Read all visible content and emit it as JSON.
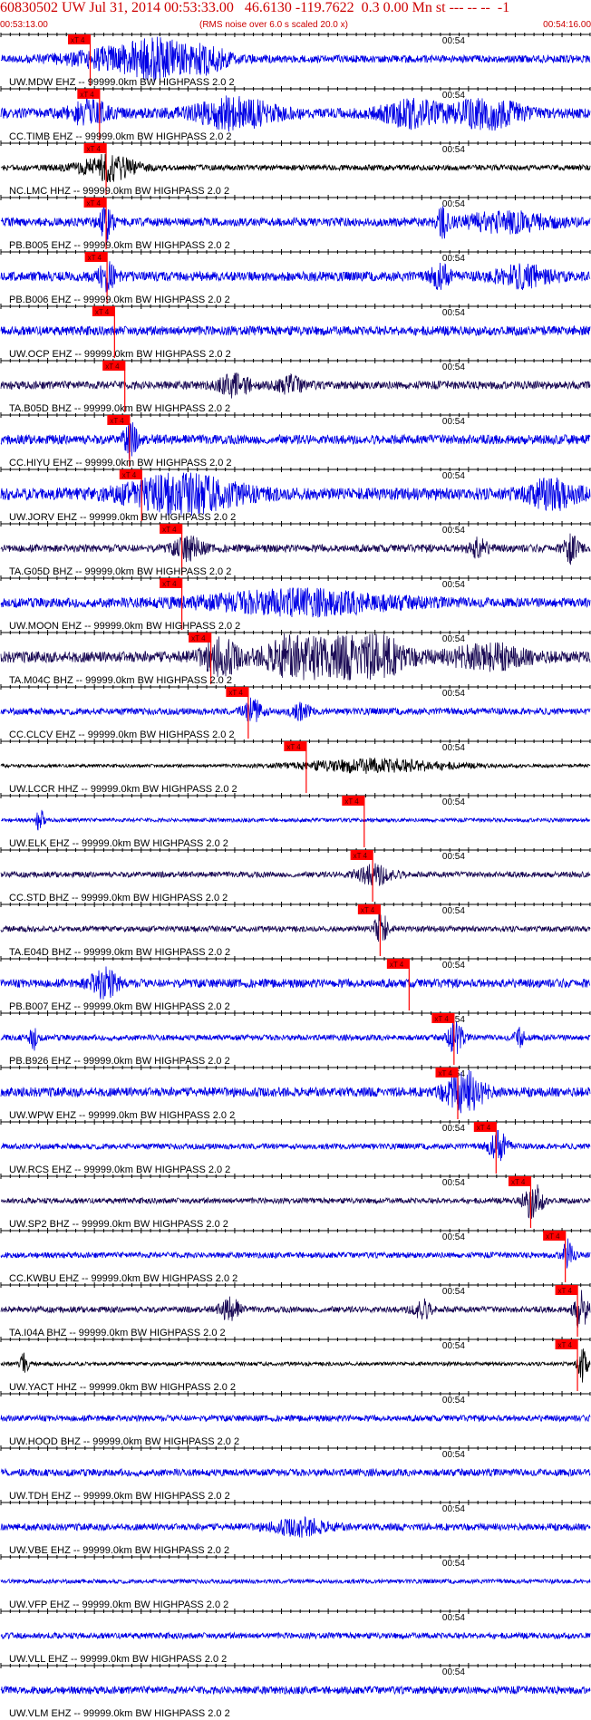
{
  "header": {
    "title": "60830502 UW Jul 31, 2014 00:53:33.00   46.6130 -119.7622  0.3 0.00 Mn st --- -- --  -1",
    "start_time": "00:53:13.00",
    "end_time": "00:54:16.00",
    "note": "(RMS noise over 6.0 s scaled 20.0 x)"
  },
  "chart_data": {
    "type": "line",
    "x_unit": "s",
    "x_range": [
      0,
      63
    ],
    "minute_mark_label": "00:54",
    "minute_mark_offset_s": 47,
    "pick_label": "xT 4",
    "colors": {
      "pick": "#ff0000",
      "pick_label_bg": "#ff0000",
      "pick_label_text": "#4a0000",
      "axis": "#000000",
      "blue_trace": "#0000e6",
      "dark_trace": "#1a0a55",
      "black_trace": "#000000"
    },
    "traces": [
      {
        "label": "UW.MDW EHZ -- 99999.0km BW  HIGHPASS  2.0  2",
        "color": "blue",
        "pick_s": 9.5,
        "amp": 0.16,
        "events": [
          [
            15,
            14,
            0.55
          ],
          [
            17,
            5,
            0.3
          ],
          [
            22,
            4,
            0.35
          ]
        ]
      },
      {
        "label": "CC.TIMB EHZ -- 99999.0km BW  HIGHPASS  2.0  2",
        "color": "blue",
        "pick_s": 10.5,
        "amp": 0.22,
        "events": [
          [
            9.5,
            4,
            0.45
          ],
          [
            25,
            8,
            0.6
          ],
          [
            44,
            6,
            0.5
          ],
          [
            52,
            7,
            0.55
          ]
        ]
      },
      {
        "label": "NC.LMC HHZ -- 99999.0km BW  HIGHPASS  2.0  2",
        "color": "black",
        "pick_s": 11.2,
        "amp": 0.12,
        "events": [
          [
            11.5,
            6,
            0.5
          ]
        ]
      },
      {
        "label": "PB.B005 EHZ -- 99999.0km BW  HIGHPASS  2.0  2",
        "color": "blue",
        "pick_s": 11.2,
        "amp": 0.18,
        "events": [
          [
            11.2,
            1.5,
            0.7
          ],
          [
            47.2,
            1,
            0.6
          ],
          [
            54,
            10,
            0.35
          ]
        ]
      },
      {
        "label": "PB.B006 EHZ -- 99999.0km BW  HIGHPASS  2.0  2",
        "color": "blue",
        "pick_s": 11.3,
        "amp": 0.2,
        "events": [
          [
            11.3,
            2,
            0.5
          ],
          [
            47,
            2,
            0.45
          ],
          [
            56,
            6,
            0.4
          ]
        ]
      },
      {
        "label": "UW.OCP EHZ -- 99999.0km BW  HIGHPASS  2.0  2",
        "color": "blue",
        "pick_s": 12.1,
        "amp": 0.2,
        "events": []
      },
      {
        "label": "TA.B05D BHZ -- 99999.0km BW  HIGHPASS  2.0  2",
        "color": "dark",
        "pick_s": 13.2,
        "amp": 0.17,
        "events": [
          [
            25,
            3,
            0.45
          ],
          [
            31,
            3,
            0.3
          ]
        ]
      },
      {
        "label": "CC.HIYU EHZ -- 99999.0km BW  HIGHPASS  2.0  2",
        "color": "blue",
        "pick_s": 13.7,
        "amp": 0.2,
        "events": [
          [
            13.8,
            1.5,
            0.65
          ]
        ]
      },
      {
        "label": "UW.JORV EHZ -- 99999.0km BW  HIGHPASS  2.0  2",
        "color": "blue",
        "pick_s": 15,
        "amp": 0.26,
        "events": [
          [
            19.5,
            12,
            0.7
          ],
          [
            59,
            5,
            0.55
          ]
        ]
      },
      {
        "label": "TA.G05D BHZ -- 99999.0km BW  HIGHPASS  2.0  2",
        "color": "dark",
        "pick_s": 19.3,
        "amp": 0.16,
        "events": [
          [
            20,
            3,
            0.45
          ],
          [
            51,
            2,
            0.35
          ],
          [
            61,
            1.5,
            0.55
          ]
        ]
      },
      {
        "label": "UW.MOON EHZ -- 99999.0km BW  HIGHPASS  2.0  2",
        "color": "blue",
        "pick_s": 19.3,
        "amp": 0.2,
        "events": [
          [
            32,
            20,
            0.45
          ]
        ]
      },
      {
        "label": "TA.M04C BHZ -- 99999.0km BW  HIGHPASS  2.0  2",
        "color": "dark",
        "pick_s": 22.4,
        "amp": 0.24,
        "events": [
          [
            23.5,
            4,
            0.7
          ],
          [
            31.5,
            6,
            1.0
          ],
          [
            39,
            8,
            1.0
          ],
          [
            52,
            8,
            0.45
          ]
        ]
      },
      {
        "label": "CC.CLCV EHZ -- 99999.0km BW  HIGHPASS  2.0  2",
        "color": "blue",
        "pick_s": 26.4,
        "amp": 0.14,
        "events": [
          [
            27,
            2,
            0.5
          ],
          [
            32,
            2,
            0.3
          ]
        ]
      },
      {
        "label": "UW.LCCR HHZ -- 99999.0km BW  HIGHPASS  2.0  2",
        "color": "black",
        "pick_s": 32.6,
        "amp": 0.07,
        "events": [
          [
            40,
            16,
            0.28
          ]
        ]
      },
      {
        "label": "UW.ELK EHZ -- 99999.0km BW  HIGHPASS  2.0  2",
        "color": "blue",
        "pick_s": 38.8,
        "amp": 0.08,
        "events": [
          [
            4.2,
            0.8,
            0.5
          ]
        ]
      },
      {
        "label": "CC.STD BHZ -- 99999.0km BW  HIGHPASS  2.0  2",
        "color": "dark",
        "pick_s": 39.7,
        "amp": 0.12,
        "events": [
          [
            40,
            4,
            0.4
          ]
        ]
      },
      {
        "label": "TA.E04D BHZ -- 99999.0km BW  HIGHPASS  2.0  2",
        "color": "dark",
        "pick_s": 40.5,
        "amp": 0.12,
        "events": [
          [
            40.6,
            1.2,
            0.9
          ]
        ]
      },
      {
        "label": "PB.B007 EHZ -- 99999.0km BW  HIGHPASS  2.0  2",
        "color": "blue",
        "pick_s": 43.6,
        "amp": 0.18,
        "events": [
          [
            11,
            3,
            0.55
          ]
        ]
      },
      {
        "label": "PB.B926 EHZ -- 99999.0km BW  HIGHPASS  2.0  2",
        "color": "blue",
        "pick_s": 48.4,
        "amp": 0.12,
        "events": [
          [
            48.6,
            1.5,
            0.7
          ],
          [
            3.5,
            0.8,
            0.55
          ],
          [
            55.5,
            1,
            0.45
          ]
        ]
      },
      {
        "label": "UW.WPW EHZ -- 99999.0km BW  HIGHPASS  2.0  2",
        "color": "blue",
        "pick_s": 48.8,
        "amp": 0.2,
        "events": [
          [
            49.5,
            4,
            0.85
          ]
        ]
      },
      {
        "label": "UW.RCS EHZ -- 99999.0km BW  HIGHPASS  2.0  2",
        "color": "blue",
        "pick_s": 52.9,
        "amp": 0.12,
        "events": [
          [
            53.2,
            2,
            0.6
          ]
        ]
      },
      {
        "label": "UW.SP2 BHZ -- 99999.0km BW  HIGHPASS  2.0  2",
        "color": "dark",
        "pick_s": 56.6,
        "amp": 0.12,
        "events": [
          [
            56.9,
            2,
            0.75
          ]
        ]
      },
      {
        "label": "CC.KWBU EHZ -- 99999.0km BW  HIGHPASS  2.0  2",
        "color": "blue",
        "pick_s": 60.3,
        "amp": 0.12,
        "events": [
          [
            60.6,
            1.2,
            0.6
          ]
        ]
      },
      {
        "label": "TA.I04A BHZ -- 99999.0km BW  HIGHPASS  2.0  2",
        "color": "dark",
        "pick_s": 61.6,
        "amp": 0.13,
        "events": [
          [
            62,
            1.5,
            0.75
          ],
          [
            24.5,
            2,
            0.5
          ],
          [
            45,
            2,
            0.4
          ]
        ]
      },
      {
        "label": "UW.YACT HHZ -- 99999.0km BW  HIGHPASS  2.0  2",
        "color": "black",
        "pick_s": 61.6,
        "amp": 0.08,
        "events": [
          [
            2.5,
            0.8,
            0.45
          ],
          [
            62.2,
            1,
            0.75
          ]
        ]
      },
      {
        "label": "UW.HOOD BHZ -- 99999.0km BW  HIGHPASS  2.0  2",
        "color": "blue",
        "pick_s": null,
        "amp": 0.13,
        "events": []
      },
      {
        "label": "UW.TDH EHZ -- 99999.0km BW  HIGHPASS  2.0  2",
        "color": "blue",
        "pick_s": null,
        "amp": 0.15,
        "events": []
      },
      {
        "label": "UW.VBE EHZ -- 99999.0km BW  HIGHPASS  2.0  2",
        "color": "blue",
        "pick_s": null,
        "amp": 0.15,
        "events": [
          [
            32,
            6,
            0.3
          ]
        ]
      },
      {
        "label": "UW.VFP EHZ -- 99999.0km BW  HIGHPASS  2.0  2",
        "color": "blue",
        "pick_s": null,
        "amp": 0.09,
        "events": []
      },
      {
        "label": "UW.VLL EHZ -- 99999.0km BW  HIGHPASS  2.0  2",
        "color": "blue",
        "pick_s": null,
        "amp": 0.13,
        "events": []
      },
      {
        "label": "UW.VLM EHZ -- 99999.0km BW  HIGHPASS  2.0  2",
        "color": "blue",
        "pick_s": null,
        "amp": 0.16,
        "events": []
      }
    ]
  }
}
